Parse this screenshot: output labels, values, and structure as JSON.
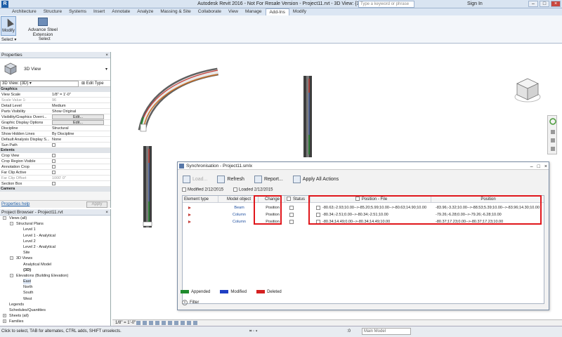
{
  "window": {
    "title": "Autodesk Revit 2016 - Not For Resale Version -",
    "file": "Project11.rvt - 3D View: {3D}",
    "search_placeholder": "Type a keyword or phrase",
    "signin": "Sign In"
  },
  "ribbon": {
    "tabs": [
      "Architecture",
      "Structure",
      "Systems",
      "Insert",
      "Annotate",
      "Analyze",
      "Massing & Site",
      "Collaborate",
      "View",
      "Manage",
      "Add-Ins",
      "Modify"
    ],
    "active_tab": "Add-Ins",
    "modify_label": "Modify",
    "ase_label": "Advance Steel Extension",
    "select_label": "Select",
    "select_group": "Select"
  },
  "properties": {
    "title": "Properties",
    "type_name": "3D View",
    "view_selector": "3D View: {3D}",
    "edit_type": "Edit Type",
    "sections": [
      {
        "name": "Graphics",
        "rows": [
          {
            "k": "View Scale",
            "v": "1/8\" = 1'-0\"",
            "kind": "text"
          },
          {
            "k": "Scale Value    1:",
            "v": "96",
            "kind": "text",
            "dim": true
          },
          {
            "k": "Detail Level",
            "v": "Medium",
            "kind": "text"
          },
          {
            "k": "Parts Visibility",
            "v": "Show Original",
            "kind": "text"
          },
          {
            "k": "Visibility/Graphics Overri...",
            "v": "Edit...",
            "kind": "button"
          },
          {
            "k": "Graphic Display Options",
            "v": "Edit...",
            "kind": "button"
          },
          {
            "k": "Discipline",
            "v": "Structural",
            "kind": "text"
          },
          {
            "k": "Show Hidden Lines",
            "v": "By Discipline",
            "kind": "text"
          },
          {
            "k": "Default Analysis Display S...",
            "v": "None",
            "kind": "text"
          },
          {
            "k": "Sun Path",
            "v": "",
            "kind": "check"
          }
        ]
      },
      {
        "name": "Extents",
        "rows": [
          {
            "k": "Crop View",
            "v": "",
            "kind": "check"
          },
          {
            "k": "Crop Region Visible",
            "v": "",
            "kind": "check"
          },
          {
            "k": "Annotation Crop",
            "v": "",
            "kind": "check"
          },
          {
            "k": "Far Clip Active",
            "v": "",
            "kind": "check"
          },
          {
            "k": "Far Clip Offset",
            "v": "1000' 0\"",
            "kind": "text",
            "dim": true
          },
          {
            "k": "Section Box",
            "v": "",
            "kind": "check"
          }
        ]
      },
      {
        "name": "Camera",
        "rows": []
      }
    ],
    "help": "Properties help",
    "apply": "Apply"
  },
  "browser": {
    "title": "Project Browser - Project11.rvt",
    "items": [
      {
        "label": "Views (all)",
        "level": 0,
        "toggle": "-"
      },
      {
        "label": "Structural Plans",
        "level": 1,
        "toggle": "-"
      },
      {
        "label": "Level 1",
        "level": 2,
        "toggle": ""
      },
      {
        "label": "Level 1 - Analytical",
        "level": 2,
        "toggle": ""
      },
      {
        "label": "Level 2",
        "level": 2,
        "toggle": ""
      },
      {
        "label": "Level 2 - Analytical",
        "level": 2,
        "toggle": ""
      },
      {
        "label": "Site",
        "level": 2,
        "toggle": ""
      },
      {
        "label": "3D Views",
        "level": 1,
        "toggle": "-"
      },
      {
        "label": "Analytical Model",
        "level": 2,
        "toggle": ""
      },
      {
        "label": "{3D}",
        "level": 2,
        "toggle": "",
        "bold": true
      },
      {
        "label": "Elevations (Building Elevation)",
        "level": 1,
        "toggle": "-"
      },
      {
        "label": "East",
        "level": 2,
        "toggle": "",
        "selected": true
      },
      {
        "label": "North",
        "level": 2,
        "toggle": ""
      },
      {
        "label": "South",
        "level": 2,
        "toggle": ""
      },
      {
        "label": "West",
        "level": 2,
        "toggle": ""
      },
      {
        "label": "Legends",
        "level": 0,
        "toggle": ""
      },
      {
        "label": "Schedules/Quantities",
        "level": 0,
        "toggle": ""
      },
      {
        "label": "Sheets (all)",
        "level": 0,
        "toggle": "+"
      },
      {
        "label": "Families",
        "level": 0,
        "toggle": "+"
      }
    ]
  },
  "dialog": {
    "title": "Synchronisation - Project11.smlx",
    "toolbar": {
      "load": "Load...",
      "refresh": "Refresh",
      "report": "Report...",
      "apply_all": "Apply All Actions"
    },
    "modified": "Modified 2/12/2015",
    "loaded": "Loaded 2/12/2015",
    "columns": {
      "element_type": "Element type",
      "model_object": "Model object",
      "change": "Change",
      "status": "Status",
      "position_file": "Position - File",
      "position": "Position"
    },
    "rows": [
      {
        "model_object": "Beam",
        "change": "Position",
        "position_file": "-80.63;-2.93;10.00-->-85.20;5.99;10.00-->-80.63;14.90;10.00",
        "position": "-83.96;-3.32;10.00-->-88.53;5.39;10.00-->-83.96;14.30;10.00"
      },
      {
        "model_object": "Column",
        "change": "Position",
        "position_file": "-80.34;-2.51;0.00-->-80.34;-2.51;10.00",
        "position": "-79.26;-6.28;0.00-->-79.26;-6.28;10.00"
      },
      {
        "model_object": "Column",
        "change": "Position",
        "position_file": "-80.34;14.49;0.00-->-80.34;14.49;10.00",
        "position": "-80.37;17.23;0.00-->-80.37;17.23;10.00"
      }
    ],
    "legend": [
      {
        "label": "Appended",
        "color": "#1f8a2c"
      },
      {
        "label": "Modified",
        "color": "#1f3fc4"
      },
      {
        "label": "Deleted",
        "color": "#d42020"
      }
    ],
    "filter": "Filter"
  },
  "viewbar": {
    "scale": "1/8\" = 1'-0\""
  },
  "status": {
    "message": "Click to select, TAB for alternates, CTRL adds, SHIFT unselects.",
    "zero": ":0",
    "model": "Main Model"
  },
  "colors": {
    "highlight": "#e0161b",
    "accent": "#1f5fa8"
  }
}
